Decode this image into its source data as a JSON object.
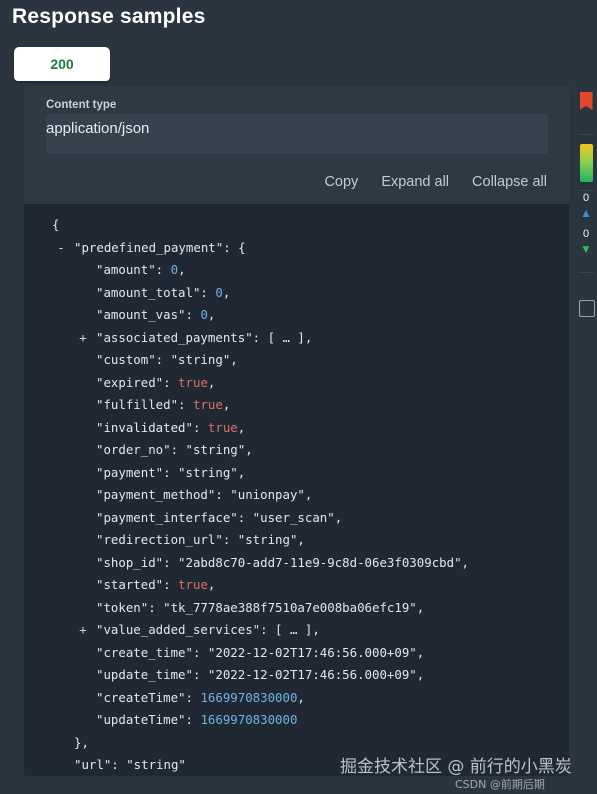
{
  "header": {
    "title": "Response samples"
  },
  "status_tabs": [
    {
      "label": "200",
      "active": true
    }
  ],
  "content_type": {
    "label": "Content type",
    "value": "application/json"
  },
  "toolbar": {
    "copy_label": "Copy",
    "expand_all_label": "Expand all",
    "collapse_all_label": "Collapse all"
  },
  "code": {
    "language": "json",
    "lines": [
      {
        "toggle": "",
        "text": "{"
      },
      {
        "toggle": "-",
        "text": "\"predefined_payment\": {"
      },
      {
        "toggle": "",
        "text": "\"amount\": 0,"
      },
      {
        "toggle": "",
        "text": "\"amount_total\": 0,"
      },
      {
        "toggle": "",
        "text": "\"amount_vas\": 0,"
      },
      {
        "toggle": "+",
        "text": "\"associated_payments\": [ … ],"
      },
      {
        "toggle": "",
        "text": "\"custom\": \"string\","
      },
      {
        "toggle": "",
        "text": "\"expired\": true,"
      },
      {
        "toggle": "",
        "text": "\"fulfilled\": true,"
      },
      {
        "toggle": "",
        "text": "\"invalidated\": true,"
      },
      {
        "toggle": "",
        "text": "\"order_no\": \"string\","
      },
      {
        "toggle": "",
        "text": "\"payment\": \"string\","
      },
      {
        "toggle": "",
        "text": "\"payment_method\": \"unionpay\","
      },
      {
        "toggle": "",
        "text": "\"payment_interface\": \"user_scan\","
      },
      {
        "toggle": "",
        "text": "\"redirection_url\": \"string\","
      },
      {
        "toggle": "",
        "text": "\"shop_id\": \"2abd8c70-add7-11e9-9c8d-06e3f0309cbd\","
      },
      {
        "toggle": "",
        "text": "\"started\": true,"
      },
      {
        "toggle": "",
        "text": "\"token\": \"tk_7778ae388f7510a7e008ba06efc19\","
      },
      {
        "toggle": "+",
        "text": "\"value_added_services\": [ … ],"
      },
      {
        "toggle": "",
        "text": "\"create_time\": \"2022-12-02T17:46:56.000+09\","
      },
      {
        "toggle": "",
        "text": "\"update_time\": \"2022-12-02T17:46:56.000+09\","
      },
      {
        "toggle": "",
        "text": "\"createTime\": 1669970830000,"
      },
      {
        "toggle": "",
        "text": "\"updateTime\": 1669970830000"
      },
      {
        "toggle": "",
        "text": "},"
      },
      {
        "toggle": "",
        "text": "\"url\": \"string\""
      },
      {
        "toggle": "",
        "text": "}"
      }
    ],
    "fields": {
      "predefined_payment": {
        "amount": 0,
        "amount_total": 0,
        "amount_vas": 0,
        "associated_payments": "[ … ]",
        "custom": "string",
        "expired": true,
        "fulfilled": true,
        "invalidated": true,
        "order_no": "string",
        "payment": "string",
        "payment_method": "unionpay",
        "payment_interface": "user_scan",
        "redirection_url": "string",
        "shop_id": "2abd8c70-add7-11e9-9c8d-06e3f0309cbd",
        "started": true,
        "token": "tk_7778ae388f7510a7e008ba06efc19",
        "value_added_services": "[ … ]",
        "create_time": "2022-12-02T17:46:56.000+09",
        "update_time": "2022-12-02T17:46:56.000+09",
        "createTime": 1669970830000,
        "updateTime": 1669970830000
      },
      "url": "string"
    }
  },
  "side_strip": {
    "flag_icon": "flag-icon",
    "rainbow_icon": "rainbow-badge-icon",
    "upvote": {
      "icon": "arrow-up-icon",
      "count": "0"
    },
    "downvote": {
      "icon": "arrow-down-icon",
      "count": "0"
    },
    "bookmark_icon": "bookmark-icon"
  },
  "watermark": {
    "primary": "掘金技术社区 @ 前行的小黑炭",
    "secondary": "CSDN @前期后期"
  },
  "colors": {
    "page_bg": "#2b3540",
    "panel_bg": "#2f3944",
    "code_bg": "#202833",
    "content_type_bg": "#38424e",
    "status_ok": "#1a7f37",
    "string": "#54c27a",
    "number": "#6fb3e0",
    "boolean": "#e06c68",
    "key": "#e8ecef",
    "upvote": "#3a8fd0",
    "downvote": "#3cb063"
  }
}
